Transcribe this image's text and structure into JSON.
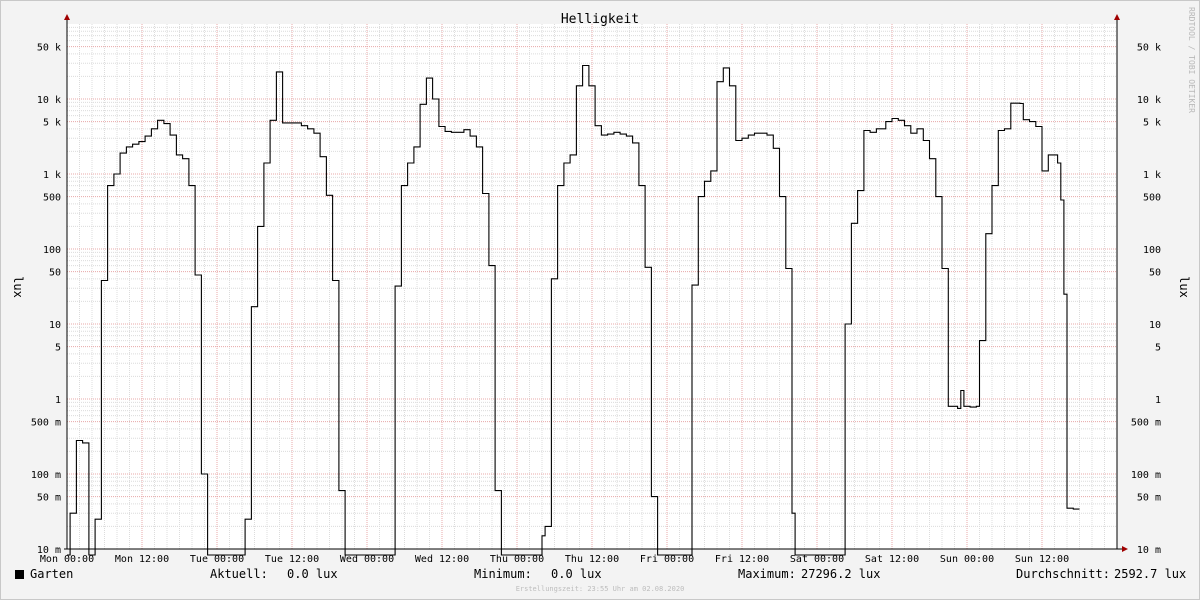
{
  "chart_data": {
    "type": "line",
    "title": "Helligkeit",
    "ylabel": "lux",
    "watermark": "RRDTOOL / TOBI OETIKER",
    "y_scale": "log",
    "ylim": [
      0.01,
      100000
    ],
    "y_ticks": [
      {
        "value": 0.01,
        "label": "10 m"
      },
      {
        "value": 0.05,
        "label": "50 m"
      },
      {
        "value": 0.1,
        "label": "100 m"
      },
      {
        "value": 0.5,
        "label": "500 m"
      },
      {
        "value": 1,
        "label": "1"
      },
      {
        "value": 5,
        "label": "5"
      },
      {
        "value": 10,
        "label": "10"
      },
      {
        "value": 50,
        "label": "50"
      },
      {
        "value": 100,
        "label": "100"
      },
      {
        "value": 500,
        "label": "500"
      },
      {
        "value": 1000,
        "label": "1 k"
      },
      {
        "value": 5000,
        "label": "5 k"
      },
      {
        "value": 10000,
        "label": "10 k"
      },
      {
        "value": 50000,
        "label": "50 k"
      }
    ],
    "x_ticks": [
      "Mon 00:00",
      "Mon 12:00",
      "Tue 00:00",
      "Tue 12:00",
      "Wed 00:00",
      "Wed 12:00",
      "Thu 00:00",
      "Thu 12:00",
      "Fri 00:00",
      "Fri 12:00",
      "Sat 00:00",
      "Sat 12:00",
      "Sun 00:00",
      "Sun 12:00"
    ],
    "xlim": [
      0,
      168
    ],
    "grid": true,
    "series": [
      {
        "name": "Garten",
        "color": "#000000",
        "step": true,
        "points": [
          [
            0,
            0
          ],
          [
            0.5,
            0.03
          ],
          [
            1.5,
            0.28
          ],
          [
            2.5,
            0.26
          ],
          [
            3.5,
            0
          ],
          [
            4.5,
            0.025
          ],
          [
            5.5,
            38
          ],
          [
            6.5,
            700
          ],
          [
            7.5,
            1000
          ],
          [
            8.5,
            1900
          ],
          [
            9.5,
            2300
          ],
          [
            10.5,
            2500
          ],
          [
            11.5,
            2700
          ],
          [
            12.5,
            3200
          ],
          [
            13.5,
            4000
          ],
          [
            14.5,
            5200
          ],
          [
            15.5,
            4700
          ],
          [
            16.5,
            3300
          ],
          [
            17.5,
            1800
          ],
          [
            18.5,
            1600
          ],
          [
            19.5,
            700
          ],
          [
            20.5,
            45
          ],
          [
            21.5,
            0.1
          ],
          [
            22.5,
            0
          ],
          [
            24,
            0
          ],
          [
            28.5,
            0.025
          ],
          [
            29.5,
            17
          ],
          [
            30.5,
            200
          ],
          [
            31.5,
            1400
          ],
          [
            32.5,
            5200
          ],
          [
            33.5,
            23000
          ],
          [
            34.5,
            4800
          ],
          [
            35.5,
            4800
          ],
          [
            37.5,
            4400
          ],
          [
            38.5,
            4000
          ],
          [
            39.5,
            3500
          ],
          [
            40.5,
            1700
          ],
          [
            41.5,
            520
          ],
          [
            42.5,
            38
          ],
          [
            43.5,
            0.06
          ],
          [
            44.5,
            0
          ],
          [
            48,
            0
          ],
          [
            52.5,
            32
          ],
          [
            53.5,
            700
          ],
          [
            54.5,
            1400
          ],
          [
            55.5,
            2300
          ],
          [
            56.5,
            8500
          ],
          [
            57.5,
            19000
          ],
          [
            58.5,
            10000
          ],
          [
            59.5,
            4300
          ],
          [
            60.5,
            3700
          ],
          [
            61.5,
            3600
          ],
          [
            63.5,
            3900
          ],
          [
            64.5,
            3200
          ],
          [
            65.5,
            2300
          ],
          [
            66.5,
            550
          ],
          [
            67.5,
            60
          ],
          [
            68.5,
            0.06
          ],
          [
            69.5,
            0
          ],
          [
            72,
            0
          ],
          [
            76,
            0.015
          ],
          [
            76.5,
            0.02
          ],
          [
            77.5,
            40
          ],
          [
            78.5,
            700
          ],
          [
            79.5,
            1400
          ],
          [
            80.5,
            1800
          ],
          [
            81.5,
            15000
          ],
          [
            82.5,
            28000
          ],
          [
            83.5,
            15000
          ],
          [
            84.5,
            4400
          ],
          [
            85.5,
            3300
          ],
          [
            86.5,
            3400
          ],
          [
            87.5,
            3600
          ],
          [
            88.5,
            3400
          ],
          [
            89.5,
            3200
          ],
          [
            90.5,
            2600
          ],
          [
            91.5,
            700
          ],
          [
            92.5,
            57
          ],
          [
            93.5,
            0.05
          ],
          [
            94.5,
            0
          ],
          [
            96,
            0
          ],
          [
            100,
            33
          ],
          [
            101,
            500
          ],
          [
            102,
            800
          ],
          [
            103,
            1100
          ],
          [
            104,
            17000
          ],
          [
            105,
            26000
          ],
          [
            106,
            15000
          ],
          [
            107,
            2800
          ],
          [
            108,
            3000
          ],
          [
            109,
            3300
          ],
          [
            110,
            3500
          ],
          [
            112,
            3300
          ],
          [
            113,
            2200
          ],
          [
            114,
            500
          ],
          [
            115,
            55
          ],
          [
            116,
            0.03
          ],
          [
            116.5,
            0
          ],
          [
            120,
            0
          ],
          [
            124.5,
            10
          ],
          [
            125.5,
            220
          ],
          [
            126.5,
            600
          ],
          [
            127.5,
            3800
          ],
          [
            128.5,
            3600
          ],
          [
            129.5,
            4000
          ],
          [
            131,
            5000
          ],
          [
            132,
            5500
          ],
          [
            133,
            5200
          ],
          [
            134,
            4400
          ],
          [
            135,
            3500
          ],
          [
            136,
            4000
          ],
          [
            137,
            2800
          ],
          [
            138,
            1600
          ],
          [
            139,
            500
          ],
          [
            140,
            55
          ],
          [
            141,
            0.8
          ],
          [
            142.5,
            0.75
          ],
          [
            143,
            1.3
          ],
          [
            143.5,
            0.8
          ],
          [
            144.5,
            0.78
          ],
          [
            145.5,
            0.8
          ],
          [
            146,
            6
          ],
          [
            147,
            160
          ],
          [
            148,
            700
          ],
          [
            149,
            3800
          ],
          [
            150,
            4000
          ],
          [
            151,
            8800
          ],
          [
            152.5,
            8700
          ],
          [
            153,
            5300
          ],
          [
            154,
            5000
          ],
          [
            155,
            4300
          ],
          [
            156,
            1100
          ],
          [
            157,
            1800
          ],
          [
            158.5,
            1400
          ],
          [
            159,
            450
          ],
          [
            159.5,
            25
          ],
          [
            160,
            0.035
          ],
          [
            161,
            0.034
          ]
        ]
      }
    ]
  },
  "legend": {
    "series_label": "Garten",
    "aktuell_label": "Aktuell:",
    "aktuell_value": "0.0 lux",
    "minimum_label": "Minimum:",
    "minimum_value": "0.0 lux",
    "maximum_label": "Maximum:",
    "maximum_value": "27296.2 lux",
    "avg_label": "Durchschnitt:",
    "avg_value": "2592.7 lux"
  },
  "footer": "Erstellungszeit: 23:55 Uhr am 02.08.2020"
}
